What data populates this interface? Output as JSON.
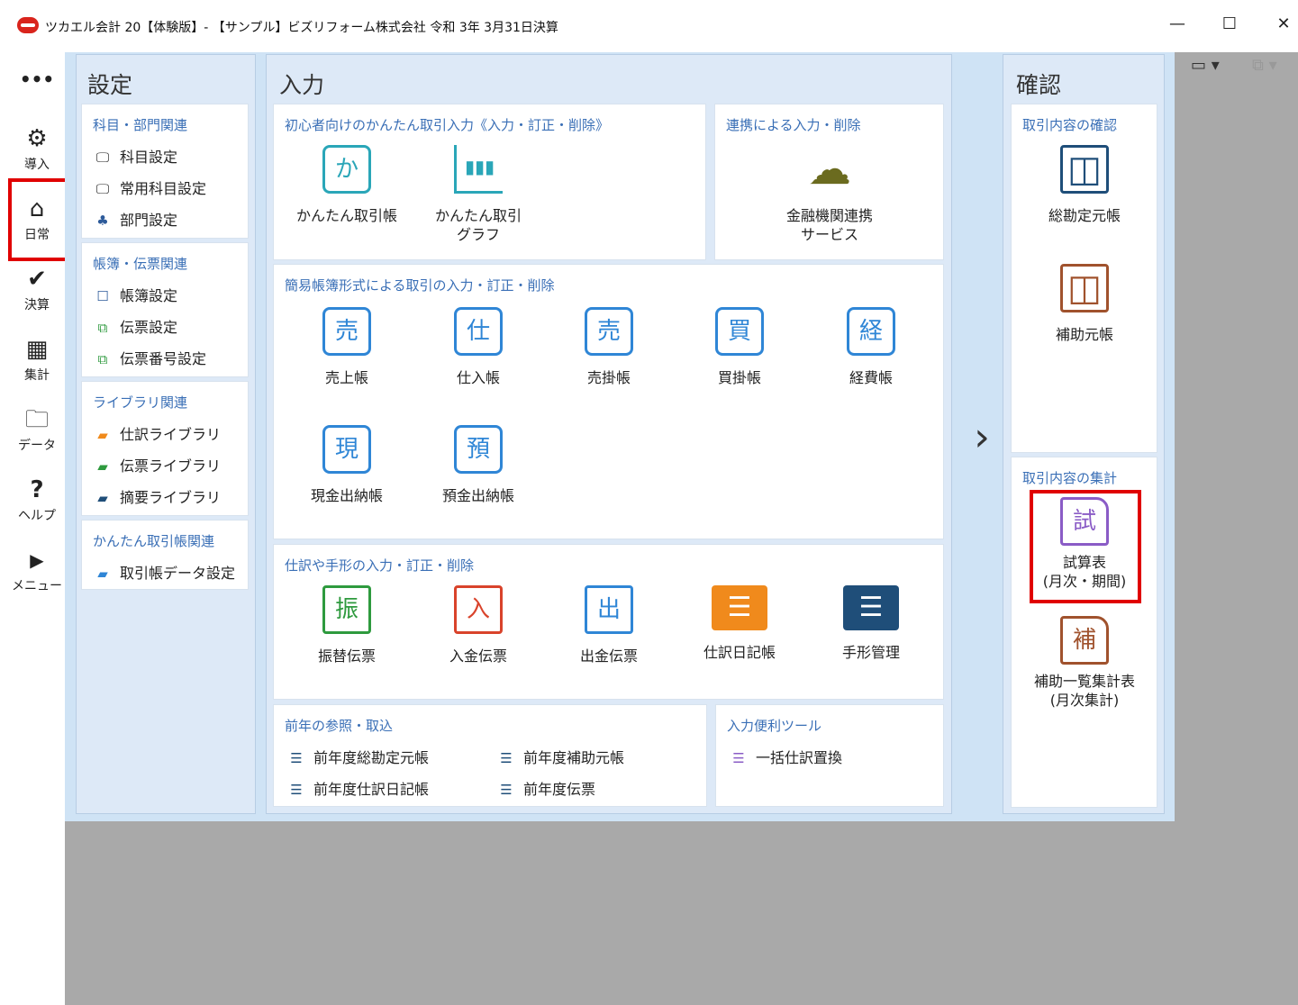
{
  "window": {
    "title": "ツカエル会計 20【体験版】- 【サンプル】ビズリフォーム株式会社 令和 3年 3月31日決算",
    "buttons": {
      "minimize": "—",
      "maximize": "☐",
      "close": "✕"
    },
    "toolbar_right": {
      "layout": "▭ ▾",
      "restore": "⧉ ▾"
    }
  },
  "sidebar": {
    "more": "•••",
    "items": [
      {
        "label": "導入",
        "icon": "gear-icon",
        "glyph": "⚙"
      },
      {
        "label": "日常",
        "icon": "home-icon",
        "glyph": "⌂"
      },
      {
        "label": "決算",
        "icon": "check-icon",
        "glyph": "✔"
      },
      {
        "label": "集計",
        "icon": "calculator-icon",
        "glyph": "▦"
      },
      {
        "label": "データ",
        "icon": "folder-icon",
        "glyph": "🗀"
      },
      {
        "label": "ヘルプ",
        "icon": "help-icon",
        "glyph": "?"
      },
      {
        "label": "メニュー",
        "icon": "play-icon",
        "glyph": "▶"
      }
    ]
  },
  "settings": {
    "title": "設定",
    "groups": [
      {
        "heading": "科目・部門関連",
        "items": [
          {
            "label": "科目設定",
            "glyph": "🖵"
          },
          {
            "label": "常用科目設定",
            "glyph": "🖵"
          },
          {
            "label": "部門設定",
            "glyph": "♣"
          }
        ]
      },
      {
        "heading": "帳簿・伝票関連",
        "items": [
          {
            "label": "帳簿設定",
            "glyph": "☐"
          },
          {
            "label": "伝票設定",
            "glyph": "⧉"
          },
          {
            "label": "伝票番号設定",
            "glyph": "⧉"
          }
        ]
      },
      {
        "heading": "ライブラリ関連",
        "items": [
          {
            "label": "仕訳ライブラリ",
            "glyph": "▰"
          },
          {
            "label": "伝票ライブラリ",
            "glyph": "▰"
          },
          {
            "label": "摘要ライブラリ",
            "glyph": "▰"
          }
        ]
      },
      {
        "heading": "かんたん取引帳関連",
        "items": [
          {
            "label": "取引帳データ設定",
            "glyph": "▰"
          }
        ]
      }
    ]
  },
  "input": {
    "title": "入力",
    "beginner": {
      "heading": "初心者向けのかんたん取引入力《入力・訂正・削除》",
      "tiles": [
        {
          "label": "かんたん取引帳",
          "glyph": "か"
        },
        {
          "label": "かんたん取引\nグラフ",
          "glyph": "▮▮▮"
        }
      ]
    },
    "linkage": {
      "heading": "連携による入力・削除",
      "tile": {
        "label": "金融機関連携\nサービス",
        "glyph": "☁"
      }
    },
    "simple": {
      "heading": "簡易帳簿形式による取引の入力・訂正・削除",
      "tiles": [
        {
          "label": "売上帳",
          "glyph": "売"
        },
        {
          "label": "仕入帳",
          "glyph": "仕"
        },
        {
          "label": "売掛帳",
          "glyph": "売"
        },
        {
          "label": "買掛帳",
          "glyph": "買"
        },
        {
          "label": "経費帳",
          "glyph": "経"
        },
        {
          "label": "現金出納帳",
          "glyph": "現"
        },
        {
          "label": "預金出納帳",
          "glyph": "預"
        }
      ]
    },
    "journal": {
      "heading": "仕訳や手形の入力・訂正・削除",
      "tiles": [
        {
          "label": "振替伝票",
          "glyph": "振",
          "color": "#2e9a3e"
        },
        {
          "label": "入金伝票",
          "glyph": "入",
          "color": "#d9432b"
        },
        {
          "label": "出金伝票",
          "glyph": "出",
          "color": "#2f86d6"
        },
        {
          "label": "仕訳日記帳",
          "glyph": "☰",
          "color": "#f08a1c"
        },
        {
          "label": "手形管理",
          "glyph": "☰",
          "color": "#1f4e79"
        }
      ]
    },
    "prev_year": {
      "heading": "前年の参照・取込",
      "items": [
        "前年度総勘定元帳",
        "前年度補助元帳",
        "前年度仕訳日記帳",
        "前年度伝票"
      ]
    },
    "tools": {
      "heading": "入力便利ツール",
      "items": [
        "一括仕訳置換"
      ]
    }
  },
  "confirm": {
    "title": "確認",
    "check": {
      "heading": "取引内容の確認",
      "tiles": [
        {
          "label": "総勘定元帳",
          "glyph": "◫",
          "color": "#1f4e79"
        },
        {
          "label": "補助元帳",
          "glyph": "◫",
          "color": "#a0522d"
        }
      ]
    },
    "summary": {
      "heading": "取引内容の集計",
      "tiles": [
        {
          "label": "試算表\n(月次・期間)",
          "glyph": "試",
          "color": "#8a5cc6"
        },
        {
          "label": "補助一覧集計表\n(月次集計)",
          "glyph": "補",
          "color": "#a0522d"
        }
      ]
    }
  },
  "nav": {
    "next": "›"
  }
}
